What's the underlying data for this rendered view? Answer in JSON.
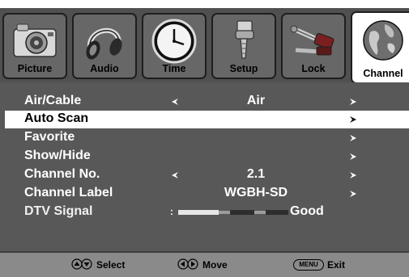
{
  "tabs": [
    {
      "label": "Picture",
      "icon": "camera-icon"
    },
    {
      "label": "Audio",
      "icon": "headphones-icon"
    },
    {
      "label": "Time",
      "icon": "clock-icon"
    },
    {
      "label": "Setup",
      "icon": "wrench-icon"
    },
    {
      "label": "Lock",
      "icon": "lock-tools-icon"
    },
    {
      "label": "Channel",
      "icon": "globe-icon",
      "active": true
    }
  ],
  "menu": [
    {
      "label": "Air/Cable",
      "value": "Air",
      "left_arrow": true,
      "right_arrow": true
    },
    {
      "label": "Auto Scan",
      "value": "",
      "left_arrow": false,
      "right_arrow": true,
      "selected": true
    },
    {
      "label": "Favorite",
      "value": "",
      "left_arrow": false,
      "right_arrow": true
    },
    {
      "label": "Show/Hide",
      "value": "",
      "left_arrow": false,
      "right_arrow": true
    },
    {
      "label": "Channel No.",
      "value": "2.1",
      "left_arrow": true,
      "right_arrow": true
    },
    {
      "label": "Channel Label",
      "value": "WGBH-SD",
      "left_arrow": false,
      "right_arrow": true
    },
    {
      "label": "DTV Signal",
      "value": "Good",
      "left_arrow": false,
      "right_arrow": false
    }
  ],
  "signal": {
    "colon": ":",
    "level": "Good"
  },
  "footer": {
    "select_label": "Select",
    "move_label": "Move",
    "menu_key": "MENU",
    "exit_label": "Exit"
  },
  "colors": {
    "panel": "#585858",
    "tabbar": "#505050",
    "selected_row": "#ffffff",
    "footer": "#8a8a8a"
  }
}
